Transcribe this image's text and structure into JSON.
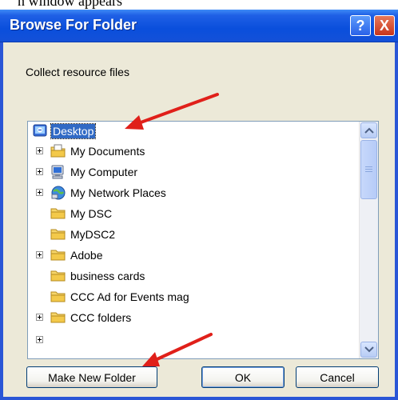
{
  "page": {
    "top_text": "n window appears"
  },
  "dialog": {
    "title": "Browse For Folder",
    "help_glyph": "?",
    "close_glyph": "X",
    "description": "Collect resource files",
    "tree": {
      "items": [
        {
          "label": "Desktop",
          "icon": "desktop-icon",
          "expandable": false,
          "selected": true
        },
        {
          "label": "My Documents",
          "icon": "my-documents-icon",
          "expandable": true
        },
        {
          "label": "My Computer",
          "icon": "my-computer-icon",
          "expandable": true
        },
        {
          "label": "My Network Places",
          "icon": "network-places-icon",
          "expandable": true
        },
        {
          "label": "My DSC",
          "icon": "folder-icon",
          "expandable": false
        },
        {
          "label": "MyDSC2",
          "icon": "folder-icon",
          "expandable": false
        },
        {
          "label": "Adobe",
          "icon": "folder-icon",
          "expandable": true
        },
        {
          "label": "business cards",
          "icon": "folder-icon",
          "expandable": false
        },
        {
          "label": "CCC Ad for Events mag",
          "icon": "folder-icon",
          "expandable": false
        },
        {
          "label": "CCC folders",
          "icon": "folder-icon",
          "expandable": true
        }
      ]
    },
    "buttons": {
      "new_folder": "Make New Folder",
      "ok": "OK",
      "cancel": "Cancel"
    }
  },
  "colors": {
    "titlebar": "#0a4fdc",
    "dialog_face": "#ece9d8",
    "selection": "#316ac5",
    "annotation_arrow": "#e0201a"
  }
}
